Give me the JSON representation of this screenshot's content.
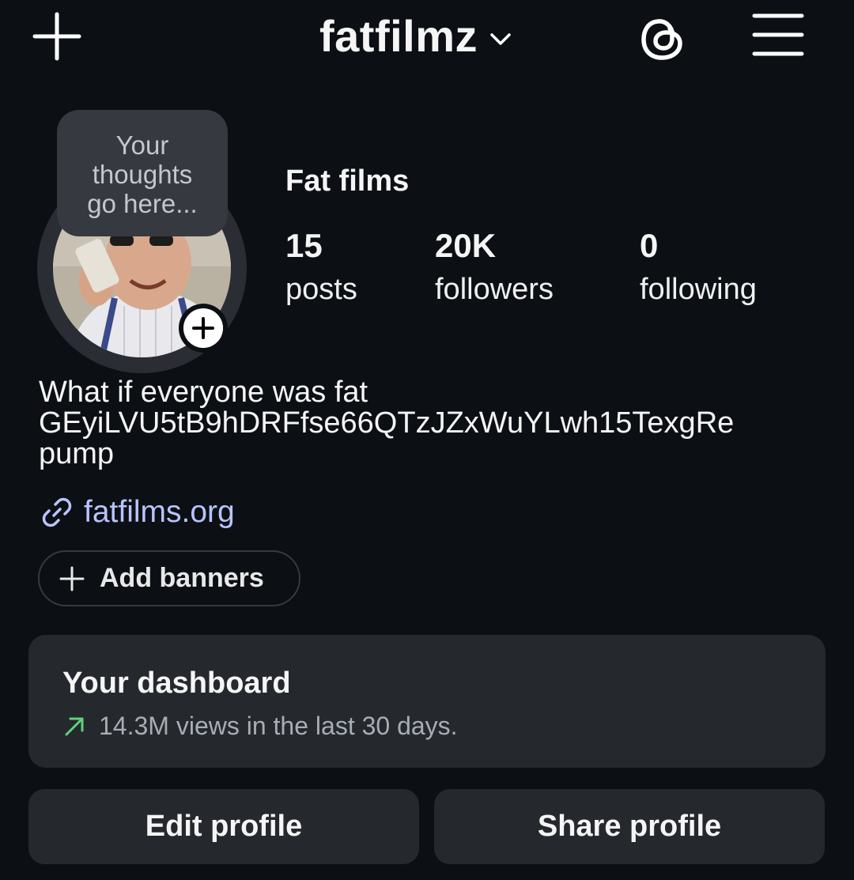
{
  "header": {
    "username": "fatfilmz",
    "icons": {
      "new_post": "plus-icon",
      "account_switch": "chevron-down-icon",
      "threads": "threads-icon",
      "menu": "hamburger-menu-icon"
    }
  },
  "note": {
    "lines": [
      "Your",
      "thoughts",
      "go here..."
    ]
  },
  "profile": {
    "display_name": "Fat films",
    "stats": [
      {
        "value": "15",
        "label": "posts"
      },
      {
        "value": "20K",
        "label": "followers"
      },
      {
        "value": "0",
        "label": "following"
      }
    ],
    "bio": [
      "What if everyone was fat",
      "GEyiLVU5tB9hDRFfse66QTzJZxWuYLwh15TexgRe",
      "pump"
    ],
    "link": "fatfilms.org"
  },
  "banners": {
    "label": "Add banners"
  },
  "dashboard": {
    "title": "Your dashboard",
    "subtitle": "14.3M views in the last 30 days."
  },
  "actions": {
    "edit": "Edit profile",
    "share": "Share profile"
  },
  "colors": {
    "background": "#0c1014",
    "card": "#25292e",
    "link": "#b8c4ff",
    "trend_up": "#5fd37a"
  }
}
